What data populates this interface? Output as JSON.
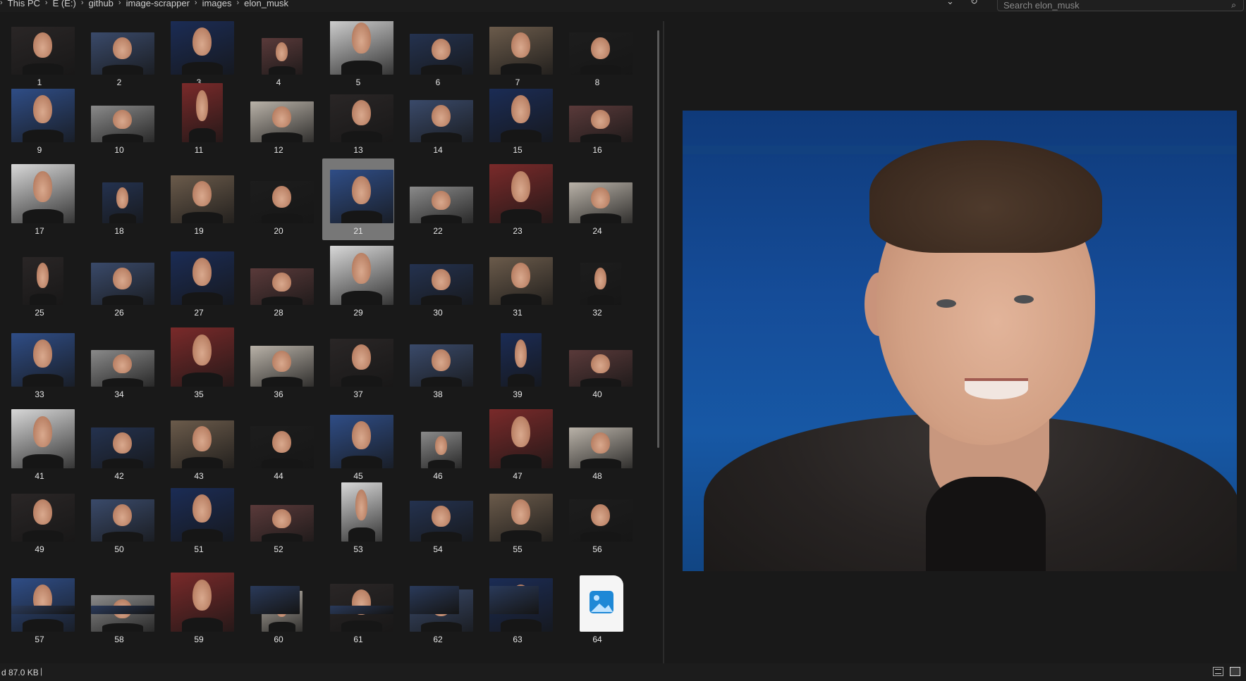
{
  "window": {
    "breadcrumb": [
      "This PC",
      "E (E:)",
      "github",
      "image-scrapper",
      "images",
      "elon_musk"
    ],
    "search_placeholder": "Search elon_musk",
    "icons": [
      "folder-icon",
      "chevron-down-icon",
      "refresh-icon",
      "search-icon"
    ]
  },
  "gallery": {
    "selected": "21",
    "items": [
      {
        "label": "1"
      },
      {
        "label": "2"
      },
      {
        "label": "3"
      },
      {
        "label": "4"
      },
      {
        "label": "5"
      },
      {
        "label": "6"
      },
      {
        "label": "7"
      },
      {
        "label": "8"
      },
      {
        "label": "9"
      },
      {
        "label": "10"
      },
      {
        "label": "11"
      },
      {
        "label": "12"
      },
      {
        "label": "13"
      },
      {
        "label": "14"
      },
      {
        "label": "15"
      },
      {
        "label": "16"
      },
      {
        "label": "17"
      },
      {
        "label": "18"
      },
      {
        "label": "19"
      },
      {
        "label": "20"
      },
      {
        "label": "21"
      },
      {
        "label": "22"
      },
      {
        "label": "23"
      },
      {
        "label": "24"
      },
      {
        "label": "25"
      },
      {
        "label": "26"
      },
      {
        "label": "27"
      },
      {
        "label": "28"
      },
      {
        "label": "29"
      },
      {
        "label": "30"
      },
      {
        "label": "31"
      },
      {
        "label": "32"
      },
      {
        "label": "33"
      },
      {
        "label": "34"
      },
      {
        "label": "35"
      },
      {
        "label": "36"
      },
      {
        "label": "37"
      },
      {
        "label": "38"
      },
      {
        "label": "39"
      },
      {
        "label": "40"
      },
      {
        "label": "41"
      },
      {
        "label": "42"
      },
      {
        "label": "43"
      },
      {
        "label": "44"
      },
      {
        "label": "45"
      },
      {
        "label": "46"
      },
      {
        "label": "47"
      },
      {
        "label": "48"
      },
      {
        "label": "49"
      },
      {
        "label": "50"
      },
      {
        "label": "51"
      },
      {
        "label": "52"
      },
      {
        "label": "53"
      },
      {
        "label": "54"
      },
      {
        "label": "55"
      },
      {
        "label": "56"
      },
      {
        "label": "57"
      },
      {
        "label": "58"
      },
      {
        "label": "59"
      },
      {
        "label": "60"
      },
      {
        "label": "61"
      },
      {
        "label": "62"
      },
      {
        "label": "63"
      },
      {
        "label": "64"
      }
    ]
  },
  "statusbar": {
    "size_text": "d  87.0 KB",
    "separator": "|",
    "view_icons": [
      "details-view-icon",
      "large-icons-view-icon"
    ]
  },
  "colors": {
    "background": "#191919",
    "selection": "#777777",
    "preview_backdrop": "#1758a5"
  }
}
